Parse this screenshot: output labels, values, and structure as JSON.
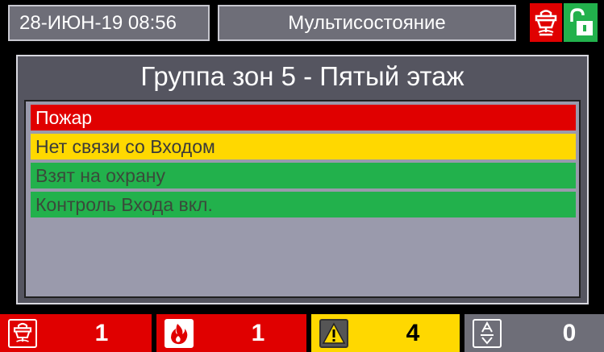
{
  "header": {
    "datetime": "28-ИЮН-19 08:56",
    "mode": "Мультисостояние",
    "status_icons": [
      "fire-alarm-icon",
      "unlocked-icon"
    ]
  },
  "panel": {
    "title": "Группа зон 5 - Пятый этаж",
    "states": [
      {
        "label": "Пожар",
        "bg": "#e00000",
        "fg": "#ffffff"
      },
      {
        "label": "Нет связи со Входом",
        "bg": "#ffd800",
        "fg": "#3a3a3a"
      },
      {
        "label": "Взят на охрану",
        "bg": "#22b14c",
        "fg": "#3a4a3a"
      },
      {
        "label": "Контроль Входа вкл.",
        "bg": "#22b14c",
        "fg": "#3a4a3a"
      }
    ]
  },
  "counters": [
    {
      "icon": "fire-alarm-icon",
      "value": "1",
      "bg": "#e00000",
      "fg": "#ffffff"
    },
    {
      "icon": "flame-icon",
      "value": "1",
      "bg": "#e00000",
      "fg": "#ffffff"
    },
    {
      "icon": "warning-icon",
      "value": "4",
      "bg": "#ffd800",
      "fg": "#000000"
    },
    {
      "icon": "test-icon",
      "value": "0",
      "bg": "#6e6e78",
      "fg": "#ffffff"
    }
  ]
}
